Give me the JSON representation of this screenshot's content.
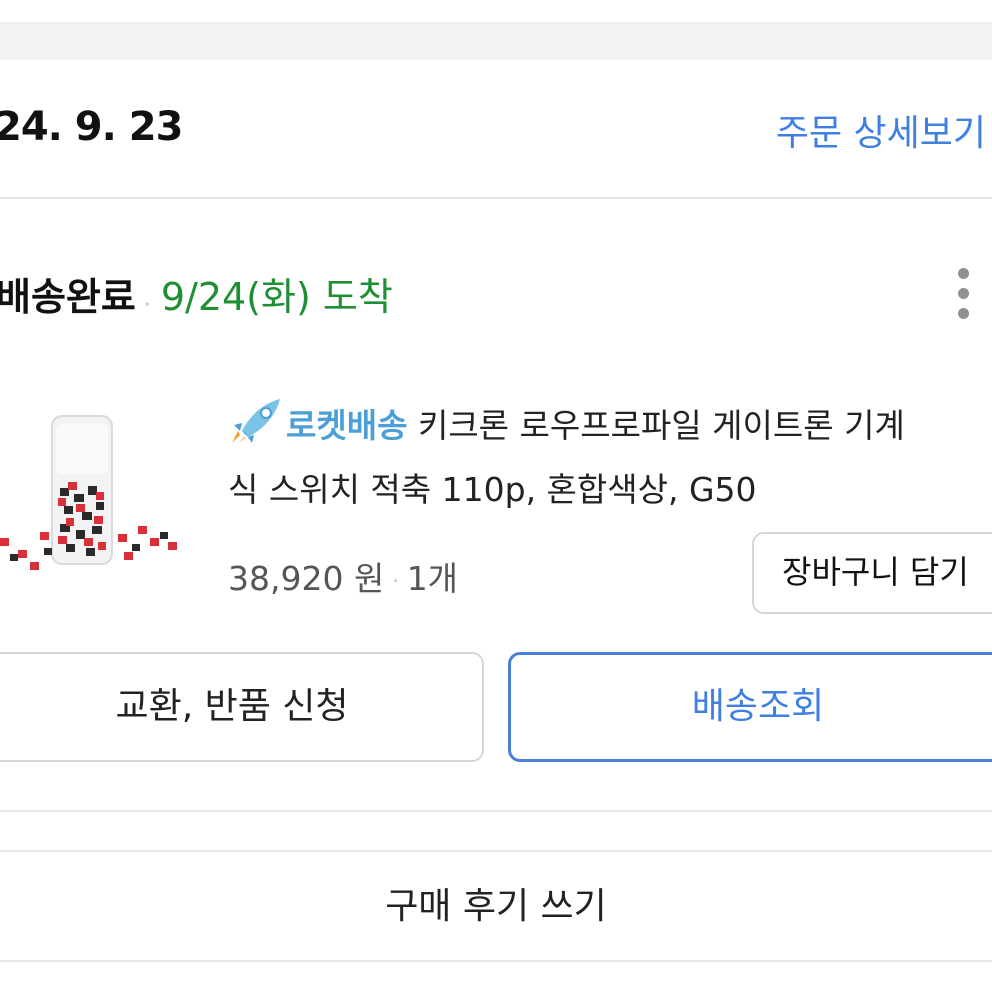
{
  "order": {
    "date": "24. 9. 23",
    "detail_link": "주문 상세보기"
  },
  "shipment": {
    "status": "배송완료",
    "separator": "·",
    "arrival": "9/24(화) 도착"
  },
  "product": {
    "badge_label": "로켓배송",
    "name_line1": "키크론 로우프로파일 게이트론 기계",
    "name_line2": "식 스위치 적축 110p, 혼합색상, G50",
    "price": "38,920 원",
    "quantity": "1개",
    "separator": "·",
    "cart_button": "장바구니 담기"
  },
  "actions": {
    "exchange_return": "교환, 반품 신청",
    "track_delivery": "배송조회",
    "write_review": "구매 후기 쓰기"
  },
  "icons": {
    "more": "more-vertical-icon",
    "rocket": "rocket-icon"
  },
  "colors": {
    "link_blue": "#3f7fe0",
    "arrival_green": "#1e8f33",
    "rocket_blue": "#4b9fd6",
    "border_gray": "#d6d6d6"
  }
}
